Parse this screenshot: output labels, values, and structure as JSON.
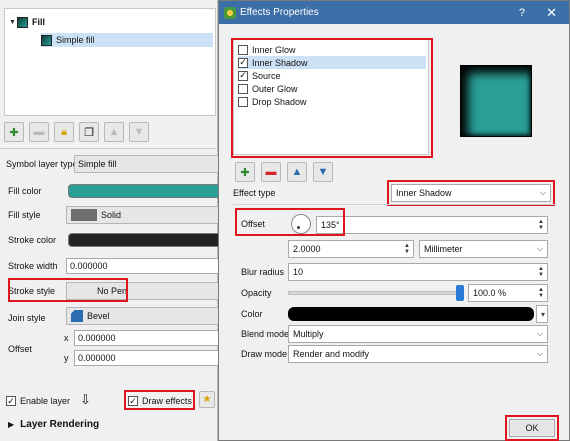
{
  "left_panel": {
    "tree": {
      "root_label": "Fill",
      "child_label": "Simple fill"
    },
    "symbol_layer_type_label": "Symbol layer type",
    "symbol_layer_type_value": "Simple fill",
    "fill_color_label": "Fill color",
    "fill_color": "#2a9f96",
    "fill_style_label": "Fill style",
    "fill_style_value": "Solid",
    "stroke_color_label": "Stroke color",
    "stroke_color": "#222222",
    "stroke_width_label": "Stroke width",
    "stroke_width_value": "0.000000",
    "stroke_style_label": "Stroke style",
    "stroke_style_value": "No Pen",
    "join_style_label": "Join style",
    "join_style_value": "Bevel",
    "offset_label": "Offset",
    "offset_x_label": "x",
    "offset_x_value": "0.000000",
    "offset_y_label": "y",
    "offset_y_value": "0.000000",
    "enable_layer_label": "Enable layer",
    "draw_effects_label": "Draw effects",
    "layer_rendering_label": "Layer Rendering"
  },
  "dialog": {
    "title": "Effects Properties",
    "help_glyph": "?",
    "close_glyph": "✕",
    "effects": [
      {
        "label": "Inner Glow",
        "checked": false
      },
      {
        "label": "Inner Shadow",
        "checked": true
      },
      {
        "label": "Source",
        "checked": true
      },
      {
        "label": "Outer Glow",
        "checked": false
      },
      {
        "label": "Drop Shadow",
        "checked": false
      }
    ],
    "check_mark": "✓",
    "effect_type_label": "Effect type",
    "effect_type_value": "Inner Shadow",
    "offset_label": "Offset",
    "offset_angle": "135°",
    "offset_distance": "2.0000",
    "offset_unit": "Millimeter",
    "blur_radius_label": "Blur radius",
    "blur_radius_value": "10",
    "opacity_label": "Opacity",
    "opacity_value": "100.0 %",
    "opacity_fraction": 1.0,
    "color_label": "Color",
    "color_value": "#000000",
    "blend_mode_label": "Blend mode",
    "blend_mode_value": "Multiply",
    "draw_mode_label": "Draw mode",
    "draw_mode_value": "Render and modify",
    "ok_label": "OK"
  },
  "colors": {
    "highlight_red": "#e0141e",
    "titlebar": "#3c6ea8",
    "selection": "#cde1f5"
  }
}
